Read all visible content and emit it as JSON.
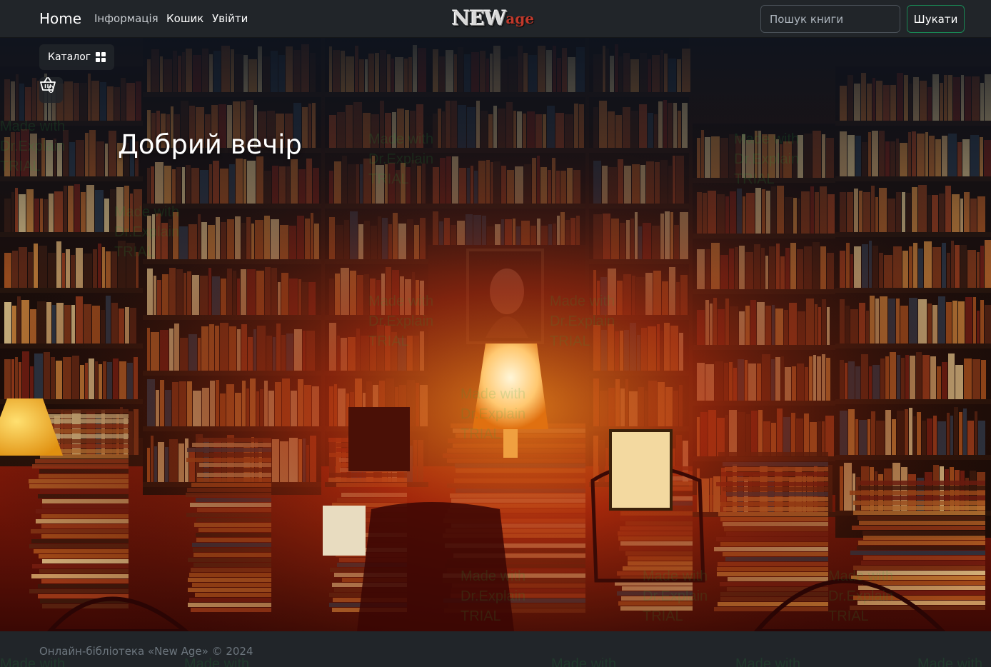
{
  "navbar": {
    "brand": "Home",
    "links": [
      "Інформація",
      "Кошик",
      "Увійти"
    ],
    "logo": {
      "main": "NEW",
      "accent": "age"
    },
    "search": {
      "placeholder": "Пошук книги",
      "button": "Шукати"
    }
  },
  "hero": {
    "catalog_label": "Каталог",
    "cart_count": "0",
    "greeting": "Добрий вечір"
  },
  "footer": {
    "text": "Онлайн-бібліотека «New Age» © 2024"
  },
  "watermark": {
    "line1": "Made with",
    "line2": "Dr.Explain",
    "line3": "TRIAL"
  },
  "colors": {
    "navbar": "#212529",
    "accent_green": "#198754",
    "logo_red": "#c0392b"
  }
}
